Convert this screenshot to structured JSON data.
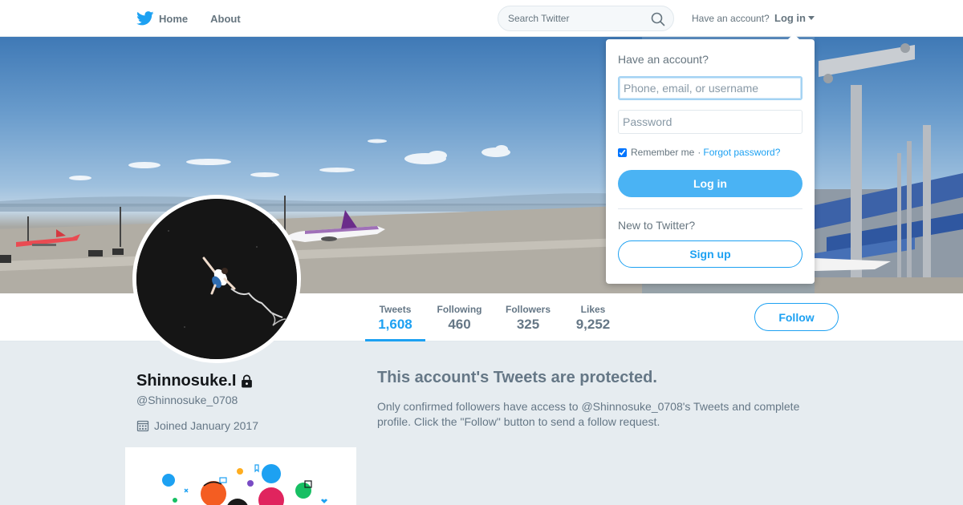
{
  "nav": {
    "home_label": "Home",
    "about_label": "About",
    "search_placeholder": "Search Twitter",
    "have_account_text": "Have an account?",
    "login_label": "Log in"
  },
  "profile": {
    "name": "Shinnosuke.I",
    "handle": "@Shinnosuke_0708",
    "joined": "Joined January 2017",
    "follow_label": "Follow",
    "stats": [
      {
        "label": "Tweets",
        "value": "1,608",
        "active": true
      },
      {
        "label": "Following",
        "value": "460"
      },
      {
        "label": "Followers",
        "value": "325"
      },
      {
        "label": "Likes",
        "value": "9,252"
      }
    ]
  },
  "protected": {
    "title": "This account's Tweets are protected.",
    "text": "Only confirmed followers have access to @Shinnosuke_0708's Tweets and complete profile. Click the \"Follow\" button to send a follow request."
  },
  "login_dropdown": {
    "heading": "Have an account?",
    "username_placeholder": "Phone, email, or username",
    "password_placeholder": "Password",
    "remember_label": "Remember me",
    "separator": "·",
    "forgot_label": "Forgot password?",
    "login_button": "Log in",
    "new_prompt": "New to Twitter?",
    "signup_button": "Sign up"
  },
  "colors": {
    "accent": "#1da1f2",
    "background": "#e6ecf0",
    "muted_text": "#657786"
  },
  "icons": [
    "twitter-bird-icon",
    "search-icon",
    "caret-down-icon",
    "lock-icon",
    "calendar-icon"
  ]
}
